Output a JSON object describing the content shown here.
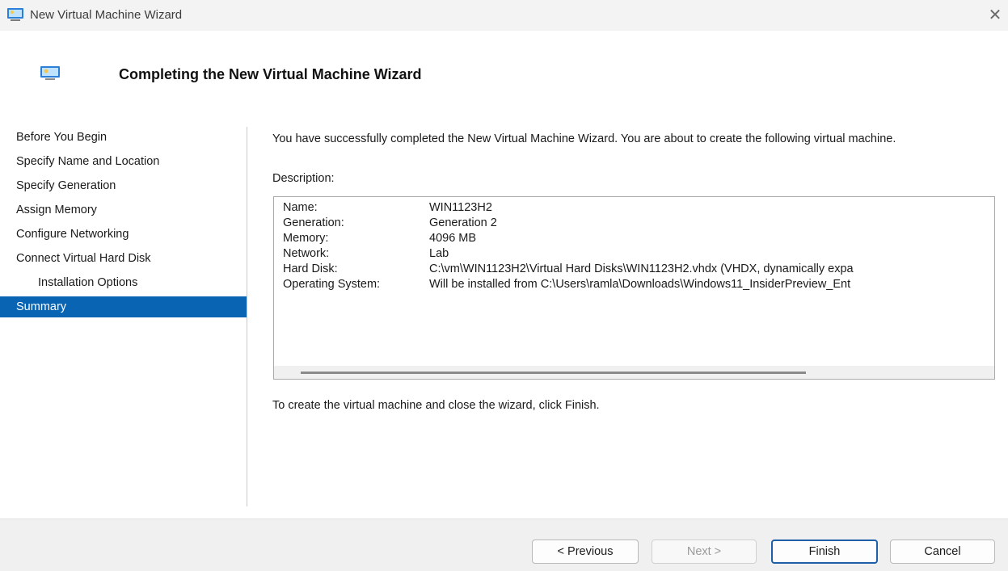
{
  "window": {
    "title": "New Virtual Machine Wizard",
    "close_glyph": "✕",
    "app_icon": "vm-window-icon"
  },
  "header": {
    "title": "Completing the New Virtual Machine Wizard",
    "icon": "vm-window-icon"
  },
  "nav": {
    "items": [
      {
        "label": "Before You Begin"
      },
      {
        "label": "Specify Name and Location"
      },
      {
        "label": "Specify Generation"
      },
      {
        "label": "Assign Memory"
      },
      {
        "label": "Configure Networking"
      },
      {
        "label": "Connect Virtual Hard Disk"
      },
      {
        "label": "Installation Options"
      },
      {
        "label": "Summary"
      }
    ],
    "selected": "Summary"
  },
  "summary": {
    "intro": "You have successfully completed the New Virtual Machine Wizard. You are about to create the following virtual machine.",
    "description_label": "Description:",
    "rows": [
      {
        "key": "Name:",
        "value": "WIN1123H2"
      },
      {
        "key": "Generation:",
        "value": "Generation 2"
      },
      {
        "key": "Memory:",
        "value": "4096 MB"
      },
      {
        "key": "Network:",
        "value": "Lab"
      },
      {
        "key": "Hard Disk:",
        "value": "C:\\vm\\WIN1123H2\\Virtual Hard Disks\\WIN1123H2.vhdx (VHDX, dynamically expa"
      },
      {
        "key": "Operating System:",
        "value": "Will be installed from C:\\Users\\ramla\\Downloads\\Windows11_InsiderPreview_Ent"
      }
    ],
    "finish_note": "To create the virtual machine and close the wizard, click Finish."
  },
  "footer": {
    "previous_label": "< Previous",
    "next_label": "Next >",
    "finish_label": "Finish",
    "cancel_label": "Cancel"
  },
  "colors": {
    "selection": "#0a64b4",
    "default_button_border": "#1f5fa8"
  }
}
